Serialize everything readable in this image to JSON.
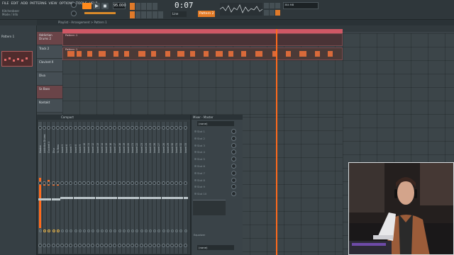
{
  "app": {
    "menu": [
      "FILE",
      "EDIT",
      "ADD",
      "PATTERNS",
      "VIEW",
      "OPTIONS",
      "TOOLS",
      "HELP"
    ],
    "song_title": "Kitchenbeer",
    "song_sub": "Mode / Info"
  },
  "transport": {
    "tempo": "95.000",
    "time": "0:07",
    "time_sub": "76",
    "pattern": "Pattern 2",
    "snap": "Line",
    "cpu": "384 MB"
  },
  "browser": {
    "item": "Pattern 1"
  },
  "playlist": {
    "title_path": "Playlist - Arrangement > Pattern 1",
    "tracks": [
      "Addiction Drums 2",
      "Track 2",
      "Clavinet X",
      "Diva",
      "Ss Bass",
      "Kontakt"
    ],
    "clip1_label": "Pattern 1",
    "clip2_label": "Pattern 1"
  },
  "mixer": {
    "title": "Compact",
    "strip_labels": [
      "Master",
      "Addiction Drums",
      "Clavinet X",
      "Diva",
      "Ss Bass",
      "Insert 5",
      "Insert 6",
      "Insert 7",
      "Insert 8",
      "Insert 9",
      "Insert 10",
      "Insert 11",
      "Insert 12",
      "Insert 13",
      "Insert 14",
      "Insert 15",
      "Insert 16",
      "Insert 17",
      "Insert 18",
      "Insert 19",
      "Insert 20",
      "Insert 21",
      "Insert 22",
      "Insert 23",
      "Insert 24",
      "Insert 25",
      "Insert 26",
      "Insert 27",
      "Insert 28",
      "Insert 29",
      "Insert 30",
      "Insert 31",
      "Insert 32",
      "Insert 33"
    ]
  },
  "insert_panel": {
    "title": "Mixer - Master",
    "input": "(none)",
    "slots": [
      "Slot 1",
      "Slot 2",
      "Slot 3",
      "Slot 4",
      "Slot 5",
      "Slot 6",
      "Slot 7",
      "Slot 8",
      "Slot 9",
      "Slot 10"
    ],
    "eq_label": "Equalizer",
    "output": "(none)"
  }
}
